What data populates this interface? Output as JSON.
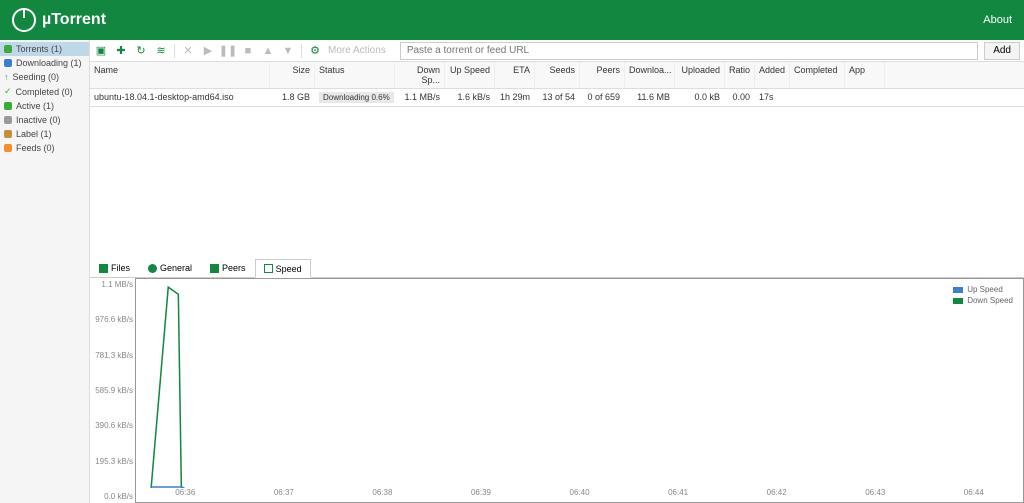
{
  "header": {
    "logo_text": "µTorrent",
    "about_link": "About"
  },
  "sidebar": {
    "items": [
      {
        "label": "Torrents (1)",
        "icon": "torrents"
      },
      {
        "label": "Downloading (1)",
        "icon": "downloading"
      },
      {
        "label": "Seeding (0)",
        "icon": "seeding"
      },
      {
        "label": "Completed (0)",
        "icon": "completed"
      },
      {
        "label": "Active (1)",
        "icon": "active"
      },
      {
        "label": "Inactive (0)",
        "icon": "inactive"
      },
      {
        "label": "Label (1)",
        "icon": "label"
      },
      {
        "label": "Feeds (0)",
        "icon": "feeds"
      }
    ]
  },
  "toolbar": {
    "more_actions": "More Actions",
    "input_placeholder": "Paste a torrent or feed URL",
    "add_button": "Add"
  },
  "grid": {
    "headers": {
      "name": "Name",
      "size": "Size",
      "status": "Status",
      "down_speed": "Down Sp...",
      "up_speed": "Up Speed",
      "eta": "ETA",
      "seeds": "Seeds",
      "peers": "Peers",
      "downloaded": "Downloa...",
      "uploaded": "Uploaded",
      "ratio": "Ratio",
      "added": "Added",
      "completed": "Completed",
      "app": "App"
    },
    "rows": [
      {
        "name": "ubuntu-18.04.1-desktop-amd64.iso",
        "size": "1.8 GB",
        "status": "Downloading 0.6%",
        "down_speed": "1.1 MB/s",
        "up_speed": "1.6 kB/s",
        "eta": "1h 29m",
        "seeds": "13 of 54",
        "peers": "0 of 659",
        "downloaded": "11.6 MB",
        "uploaded": "0.0 kB",
        "ratio": "0.00",
        "added": "17s",
        "completed": "",
        "app": ""
      }
    ]
  },
  "tabs": {
    "files": "Files",
    "general": "General",
    "peers": "Peers",
    "speed": "Speed"
  },
  "chart": {
    "y_ticks": [
      "1.1 MB/s",
      "976.6 kB/s",
      "781.3 kB/s",
      "585.9 kB/s",
      "390.6 kB/s",
      "195.3 kB/s",
      "0.0 kB/s"
    ],
    "x_ticks": [
      "06:36",
      "06:37",
      "06:38",
      "06:39",
      "06:40",
      "06:41",
      "06:42",
      "06:43",
      "06:44"
    ],
    "legend": {
      "up": "Up Speed",
      "down": "Down Speed"
    }
  },
  "chart_data": {
    "type": "line",
    "title": "",
    "xlabel": "",
    "ylabel": "",
    "ylim_kbps": [
      0,
      1126
    ],
    "x": [
      "06:36",
      "06:37",
      "06:38",
      "06:39",
      "06:40",
      "06:41",
      "06:42",
      "06:43",
      "06:44"
    ],
    "series": [
      {
        "name": "Up Speed",
        "color": "#3a7fd4",
        "values_kbps": [
          1.6,
          null,
          null,
          null,
          null,
          null,
          null,
          null,
          null
        ]
      },
      {
        "name": "Down Speed",
        "color": "#118740",
        "values_kbps": [
          1126,
          null,
          null,
          null,
          null,
          null,
          null,
          null,
          null
        ]
      }
    ],
    "note": "Only first data point present; chart rises sharply from 0 to ~1.1 MB/s near start"
  }
}
